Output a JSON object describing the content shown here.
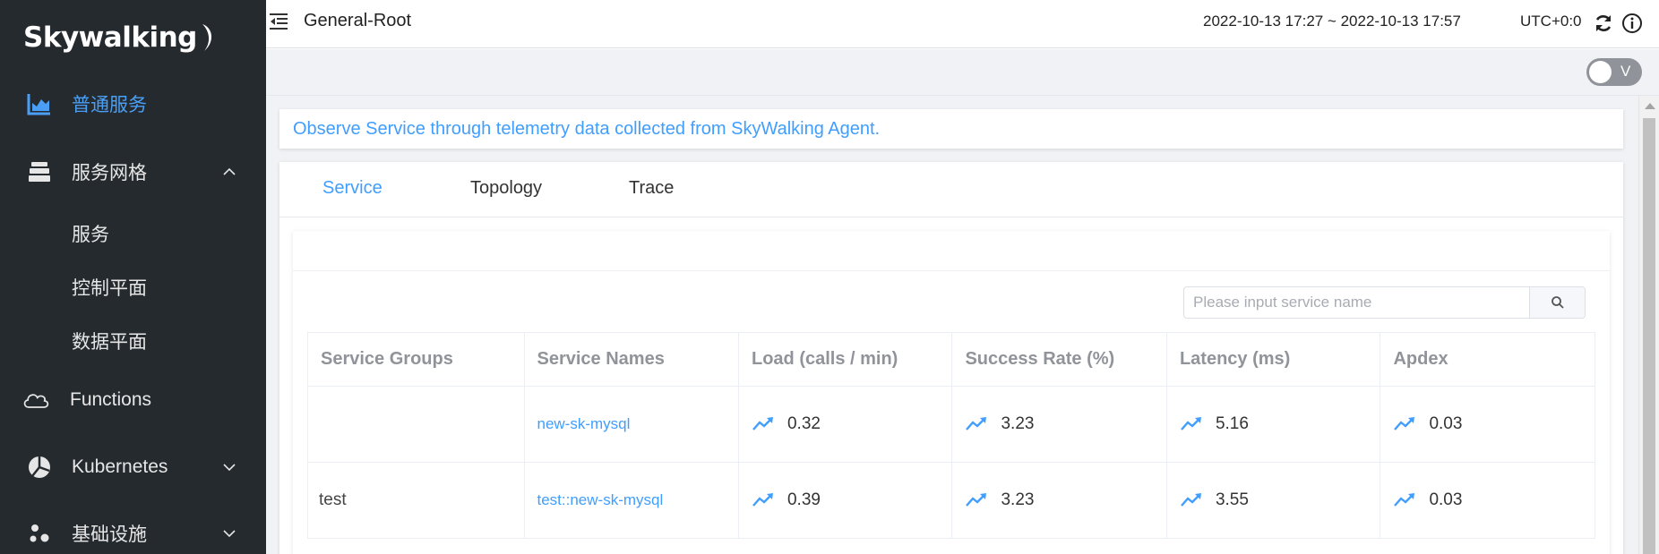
{
  "sidebar": {
    "logo": "Skywalking",
    "items": [
      {
        "label": "普通服务",
        "icon": "bar-chart-icon",
        "active": true
      },
      {
        "label": "服务网格",
        "icon": "layers-icon",
        "expanded": true,
        "children": [
          "服务",
          "控制平面",
          "数据平面"
        ]
      },
      {
        "label": "Functions",
        "icon": "cloud-icon"
      },
      {
        "label": "Kubernetes",
        "icon": "pie-icon",
        "expanded": false
      },
      {
        "label": "基础设施",
        "icon": "dots-icon",
        "expanded": false
      }
    ]
  },
  "header": {
    "title": "General-Root",
    "time_range": "2022-10-13 17:27 ~ 2022-10-13 17:57",
    "timezone": "UTC+0:0"
  },
  "toolbar": {
    "toggle_label": "V"
  },
  "banner": {
    "text": "Observe Service through telemetry data collected from SkyWalking Agent."
  },
  "tabs": [
    {
      "label": "Service",
      "active": true
    },
    {
      "label": "Topology",
      "active": false
    },
    {
      "label": "Trace",
      "active": false
    }
  ],
  "search": {
    "placeholder": "Please input service name"
  },
  "table": {
    "headers": [
      "Service Groups",
      "Service Names",
      "Load (calls / min)",
      "Success Rate (%)",
      "Latency (ms)",
      "Apdex"
    ],
    "rows": [
      {
        "group": "",
        "name": "new-sk-mysql",
        "load": "0.32",
        "success_rate": "3.23",
        "latency": "5.16",
        "apdex": "0.03"
      },
      {
        "group": "test",
        "name": "test::new-sk-mysql",
        "load": "0.39",
        "success_rate": "3.23",
        "latency": "3.55",
        "apdex": "0.03"
      }
    ]
  },
  "colors": {
    "sidebar_bg": "#252a2f",
    "accent": "#409eff",
    "active_nav": "#4a9ff5"
  }
}
